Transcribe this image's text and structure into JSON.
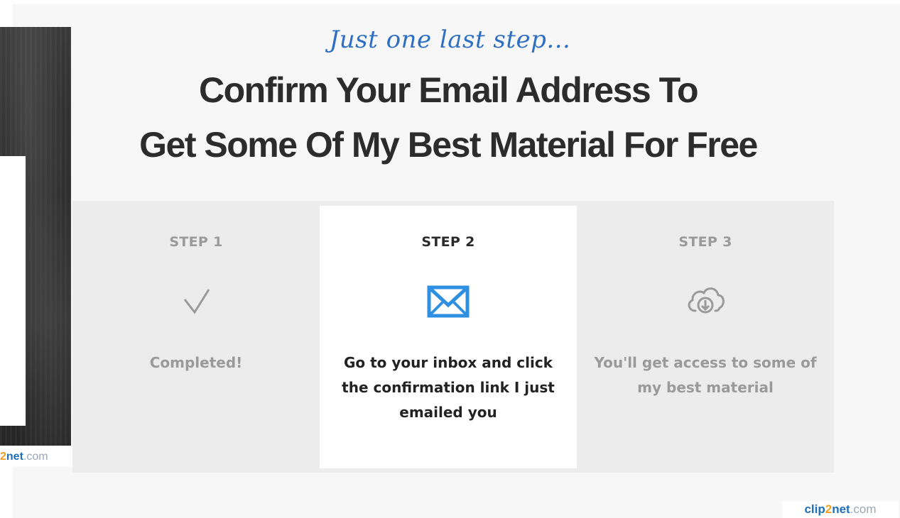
{
  "header": {
    "eyebrow": "Just one last step...",
    "headline_line1": "Confirm Your Email Address To",
    "headline_line2": "Get Some Of My Best Material For Free"
  },
  "steps": [
    {
      "label": "STEP 1",
      "icon": "checkmark-icon",
      "description": "Completed!",
      "state": "completed"
    },
    {
      "label": "STEP 2",
      "icon": "envelope-icon",
      "description": "Go to your inbox and click the confirmation link I just emailed you",
      "state": "active"
    },
    {
      "label": "STEP 3",
      "icon": "cloud-download-icon",
      "description": "You'll get access to some of my best material",
      "state": "upcoming"
    }
  ],
  "watermark": {
    "brand_a": "clip",
    "brand_two": "2",
    "brand_b": "net",
    "brand_com": ".com",
    "left_fragment_b": "net",
    "left_fragment_two": "2"
  },
  "colors": {
    "accent_blue": "#2f6fc2",
    "icon_blue": "#2f8fe0",
    "muted_gray": "#9a9a9a",
    "headline": "#2c2c2c"
  }
}
